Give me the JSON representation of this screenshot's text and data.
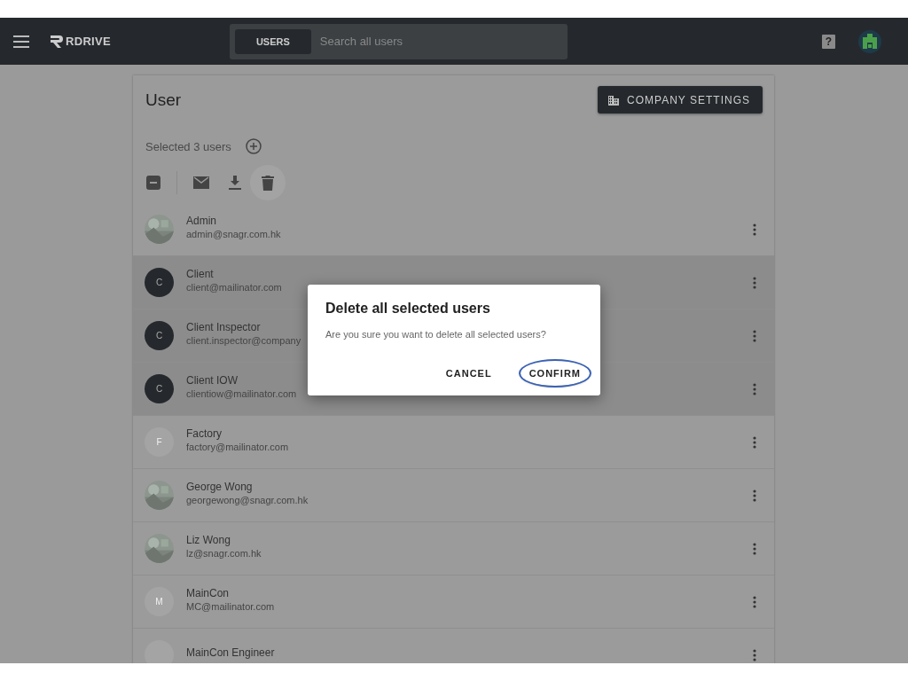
{
  "header": {
    "brand": "RDRIVE",
    "help": "?",
    "search": {
      "scope": "USERS",
      "placeholder": "Search all users"
    }
  },
  "page": {
    "title": "User",
    "company_settings": "COMPANY SETTINGS",
    "selection_label": "Selected 3 users",
    "bulk_select": {
      "indeterminate": true
    }
  },
  "users": [
    {
      "name": "Admin",
      "email": "admin@snagr.com.hk",
      "selected": false
    },
    {
      "name": "Client",
      "email": "client@mailinator.com",
      "selected": true,
      "avatar": {
        "kind": "initial",
        "letter": "C"
      }
    },
    {
      "name": "Client Inspector",
      "email": "client.inspector@company",
      "selected": true,
      "avatar": {
        "kind": "initial",
        "letter": "C"
      }
    },
    {
      "name": "Client IOW",
      "email": "clientiow@mailinator.com",
      "selected": true,
      "avatar": {
        "kind": "initial",
        "letter": "C"
      }
    },
    {
      "name": "Factory",
      "email": "factory@mailinator.com",
      "selected": false,
      "avatar": {
        "kind": "initial",
        "letter": "F"
      }
    },
    {
      "name": "George Wong",
      "email": "georgewong@snagr.com.hk",
      "selected": false
    },
    {
      "name": "Liz Wong",
      "email": "lz@snagr.com.hk",
      "selected": false
    },
    {
      "name": "MainCon",
      "email": "MC@mailinator.com",
      "selected": false,
      "avatar": {
        "kind": "initial",
        "letter": "M"
      }
    },
    {
      "name": "MainCon Engineer",
      "selected": false,
      "avatar": {
        "kind": "initial"
      }
    }
  ],
  "dialog": {
    "title": "Delete all selected users",
    "message": "Are you sure you want to delete all selected users?",
    "buttons": [
      {
        "label": "CANCEL",
        "highlighted": false
      },
      {
        "label": "CONFIRM",
        "highlighted": true
      }
    ]
  }
}
